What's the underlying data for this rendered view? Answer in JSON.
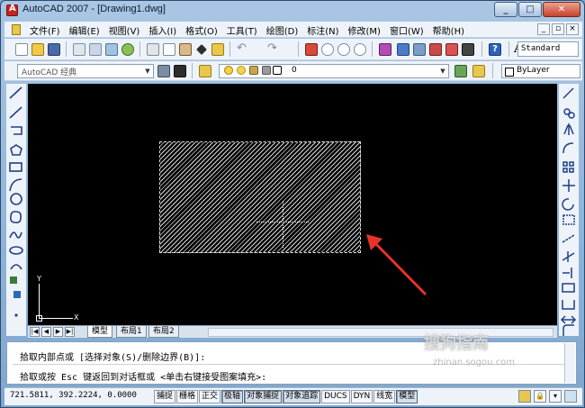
{
  "window": {
    "title": "AutoCAD 2007 - [Drawing1.dwg]",
    "buttons": [
      "_",
      "□",
      "✕"
    ]
  },
  "menu": {
    "items": [
      "文件(F)",
      "编辑(E)",
      "视图(V)",
      "插入(I)",
      "格式(O)",
      "工具(T)",
      "绘图(D)",
      "标注(N)",
      "修改(M)",
      "窗口(W)",
      "帮助(H)"
    ],
    "mdi_buttons": [
      "_",
      "▫",
      "×"
    ]
  },
  "toolbar": {
    "text_style": "Standard",
    "workspace": "AutoCAD 经典",
    "layer": "0",
    "color": "ByLayer"
  },
  "layout_tabs": [
    "模型",
    "布局1",
    "布局2"
  ],
  "ucs": {
    "x_label": "X",
    "y_label": "Y"
  },
  "command": {
    "line1": "拾取内部点或 [选择对象(S)/删除边界(B)]:",
    "line2": "拾取或按 Esc 键返回到对话框或 <单击右键接受图案填充>:"
  },
  "status": {
    "coords": "721.5811, 392.2224, 0.0000",
    "modes": [
      {
        "label": "捕捉",
        "on": false
      },
      {
        "label": "栅格",
        "on": false
      },
      {
        "label": "正交",
        "on": false
      },
      {
        "label": "极轴",
        "on": true
      },
      {
        "label": "对象捕捉",
        "on": true
      },
      {
        "label": "对象追踪",
        "on": true
      },
      {
        "label": "DUCS",
        "on": false
      },
      {
        "label": "DYN",
        "on": false
      },
      {
        "label": "线宽",
        "on": false
      },
      {
        "label": "模型",
        "on": true
      }
    ]
  },
  "watermark": {
    "text": "搜狗指南",
    "sub": "zhinan.sogou.com"
  },
  "colors": {
    "canvas": "#000000",
    "annotation_arrow": "#e8332a",
    "hatch": "#d8d8d8"
  }
}
